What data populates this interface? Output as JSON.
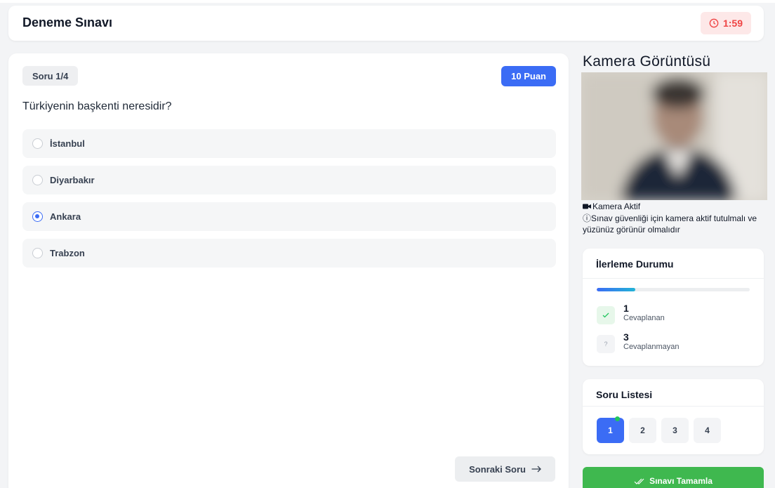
{
  "header": {
    "title": "Deneme Sınavı",
    "timer": "1:59",
    "timer_icon": "clock-icon"
  },
  "question": {
    "counter": "Soru 1/4",
    "points": "10 Puan",
    "text": "Türkiyenin başkenti neresidir?",
    "options": [
      {
        "label": "İstanbul",
        "selected": false
      },
      {
        "label": "Diyarbakır",
        "selected": false
      },
      {
        "label": "Ankara",
        "selected": true
      },
      {
        "label": "Trabzon",
        "selected": false
      }
    ],
    "next_label": "Sonraki Soru",
    "next_icon": "arrow-right-icon"
  },
  "camera": {
    "title": "Kamera Görüntüsü",
    "status": "Kamera Aktif",
    "note": "ⓘSınav güvenliği için kamera aktif tutulmalı ve yüzünüz görünür olmalıdır"
  },
  "progress": {
    "title": "İlerleme Durumu",
    "fraction": 0.25,
    "answered_count": "1",
    "answered_label": "Cevaplanan",
    "unanswered_count": "3",
    "unanswered_label": "Cevaplanmayan"
  },
  "question_list": {
    "title": "Soru Listesi",
    "items": [
      "1",
      "2",
      "3",
      "4"
    ]
  },
  "finish": {
    "label": "Sınavı Tamamla"
  },
  "colors": {
    "accent": "#3b6cf5",
    "success": "#3fb84f",
    "danger": "#ef4444"
  }
}
